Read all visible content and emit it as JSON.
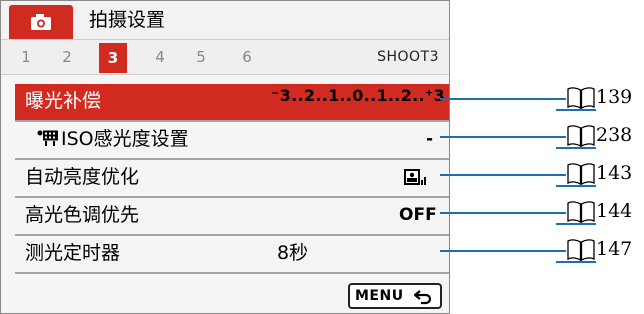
{
  "header": {
    "title": "拍摄设置",
    "camera_tab_icon": "camera-icon"
  },
  "tabs": [
    {
      "label": "1",
      "active": false
    },
    {
      "label": "2",
      "active": false
    },
    {
      "label": "3",
      "active": true
    },
    {
      "label": "4",
      "active": false
    },
    {
      "label": "5",
      "active": false
    },
    {
      "label": "6",
      "active": false
    }
  ],
  "page_code": "SHOOT3",
  "menu_items": [
    {
      "label": "曝光补偿",
      "value": "⁻3..2..1..0..1..2..⁺3",
      "selected": true
    },
    {
      "label": "ISO感光度设置",
      "label_icon": "movie-icon",
      "value": "-",
      "selected": false
    },
    {
      "label": "自动亮度优化",
      "value_icon": "auto-lighting-optimizer-icon",
      "value": "",
      "selected": false
    },
    {
      "label": "高光色调优先",
      "value": "OFF",
      "selected": false
    },
    {
      "label": "测光定时器",
      "value": "8秒",
      "selected": false
    }
  ],
  "footer": {
    "menu_label": "MENU",
    "back_icon": "return-icon"
  },
  "page_refs": [
    {
      "page": "139",
      "icon": "book-icon"
    },
    {
      "page": "238",
      "icon": "book-icon"
    },
    {
      "page": "143",
      "icon": "book-icon"
    },
    {
      "page": "144",
      "icon": "book-icon"
    },
    {
      "page": "147",
      "icon": "book-icon"
    }
  ],
  "colors": {
    "accent": "#d12a20",
    "leader_line": "#1e6fb0",
    "panel_bg": "#f5f5f5"
  }
}
